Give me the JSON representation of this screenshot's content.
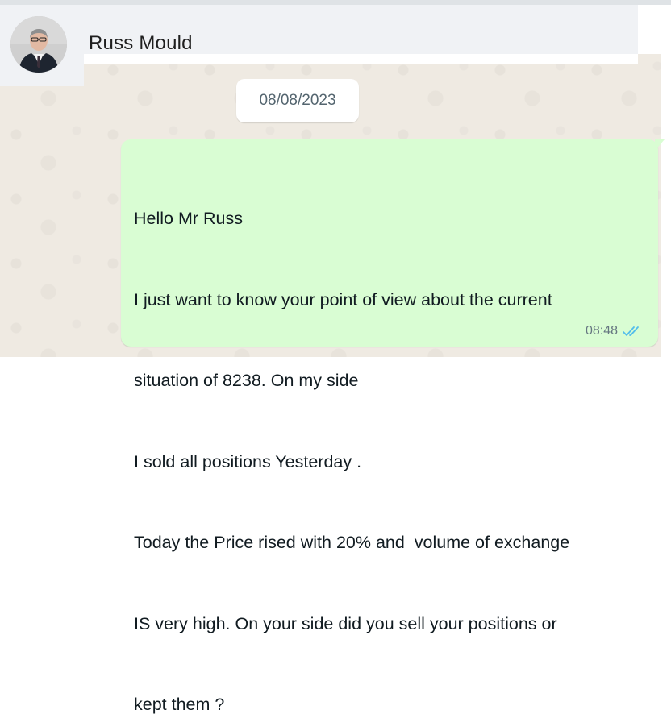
{
  "contact": {
    "name": "Russ Mould"
  },
  "chat": {
    "date_divider": "08/08/2023",
    "message": {
      "lines": [
        "Hello Mr Russ",
        "I just want to know your point of view about the current",
        "situation of 8238. On my side",
        "I sold all positions Yesterday .",
        "Today the Price rised with 20% and  volume of exchange",
        "IS very high. On your side did you sell your positions or",
        "kept them ?"
      ],
      "time": "08:48",
      "status_icon": "double-check-icon",
      "status_color": "#53bdeb",
      "bubble_color": "#d9fdd3"
    }
  }
}
